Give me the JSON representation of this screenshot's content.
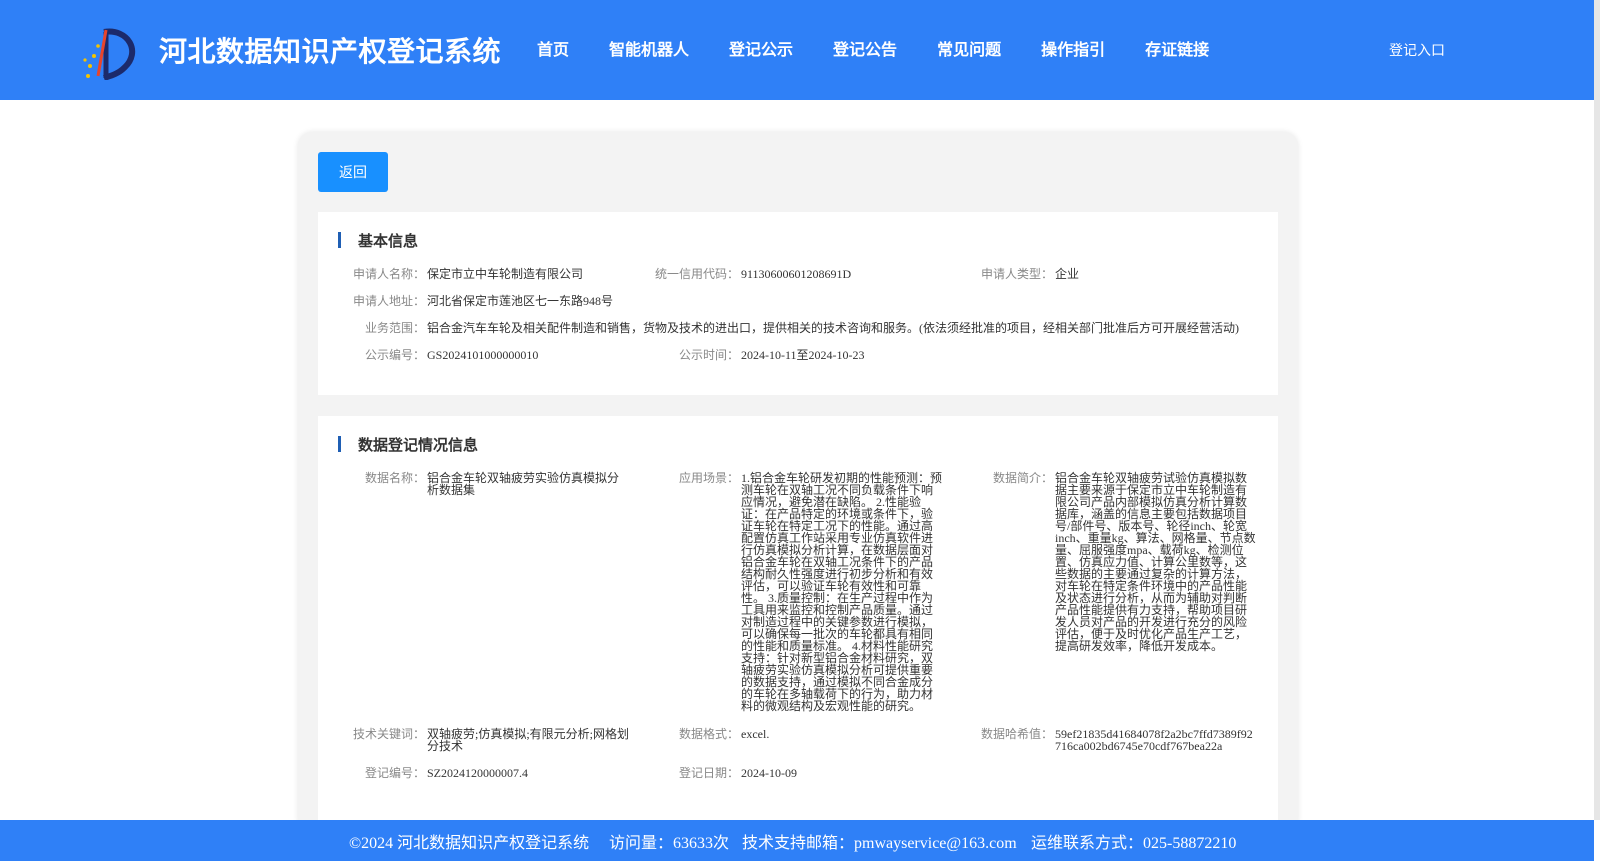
{
  "site": {
    "title": "河北数据知识产权登记系统"
  },
  "nav": {
    "items": [
      "首页",
      "智能机器人",
      "登记公示",
      "登记公告",
      "常见问题",
      "操作指引",
      "存证链接"
    ],
    "login": "登记入口"
  },
  "actions": {
    "back": "返回"
  },
  "basic": {
    "title": "基本信息",
    "applicant_name_label": "申请人名称：",
    "applicant_name": "保定市立中车轮制造有限公司",
    "credit_code_label": "统一信用代码：",
    "credit_code": "91130600601208691D",
    "applicant_type_label": "申请人类型：",
    "applicant_type": "企业",
    "address_label": "申请人地址：",
    "address": "河北省保定市莲池区七一东路948号",
    "scope_label": "业务范围：",
    "scope": "铝合金汽车车轮及相关配件制造和销售，货物及技术的进出口，提供相关的技术咨询和服务。(依法须经批准的项目，经相关部门批准后方可开展经营活动)",
    "notice_no_label": "公示编号：",
    "notice_no": "GS2024101000000010",
    "notice_time_label": "公示时间：",
    "notice_time": "2024-10-11至2024-10-23"
  },
  "data_info": {
    "title": "数据登记情况信息",
    "name_label": "数据名称：",
    "name": "铝合金车轮双轴疲劳实验仿真模拟分析数据集",
    "scene_label": "应用场景：",
    "scene": "1.铝合金车轮研发初期的性能预测：预测车轮在双轴工况不同负载条件下响应情况，避免潜在缺陷。 2.性能验证：在产品特定的环境或条件下，验证车轮在特定工况下的性能。通过高配置仿真工作站采用专业仿真软件进行仿真模拟分析计算，在数据层面对铝合金车轮在双轴工况条件下的产品结构耐久性强度进行初步分析和有效评估，可以验证车轮有效性和可靠性。 3.质量控制：在生产过程中作为工具用来监控和控制产品质量。通过对制造过程中的关键参数进行模拟，可以确保每一批次的车轮都具有相同的性能和质量标准。 4.材料性能研究支持：针对新型铝合金材料研究，双轴疲劳实验仿真模拟分析可提供重要的数据支持，通过模拟不同合金成分的车轮在多轴载荷下的行为，助力材料的微观结构及宏观性能的研究。",
    "intro_label": "数据简介：",
    "intro": "铝合金车轮双轴疲劳试验仿真模拟数据主要来源于保定市立中车轮制造有限公司产品内部模拟仿真分析计算数据库，涵盖的信息主要包括数据项目号/部件号、版本号、轮径inch、轮宽inch、重量kg、算法、网格量、节点数量、屈服强度mpa、载荷kg、检测位置、仿真应力值、计算公里数等，这些数据的主要通过复杂的计算方法，对车轮在特定条件环境中的产品性能及状态进行分析，从而为辅助对判断产品性能提供有力支持，帮助项目研发人员对产品的开发进行充分的风险评估，便于及时优化产品生产工艺，提高研发效率，降低开发成本。",
    "keywords_label": "技术关键词：",
    "keywords": "双轴疲劳;仿真模拟;有限元分析;网格划分技术",
    "format_label": "数据格式：",
    "format": "excel.",
    "hash_label": "数据哈希值：",
    "hash": "59ef21835d41684078f2a2bc7ffd7389f92716ca002bd6745e70cdf767bea22a",
    "reg_no_label": "登记编号：",
    "reg_no": "SZ2024120000007.4",
    "reg_date_label": "登记日期：",
    "reg_date": "2024-10-09"
  },
  "footer": {
    "copyright": "©2024 河北数据知识产权登记系统",
    "visits": "访问量：63633次",
    "email": "技术支持邮箱：pmwayservice@163.com",
    "phone": "运维联系方式：025-58872210"
  },
  "colors": {
    "header": "#2f80f7",
    "button": "#1890ff",
    "accent_bar": "#1f5fb4"
  }
}
